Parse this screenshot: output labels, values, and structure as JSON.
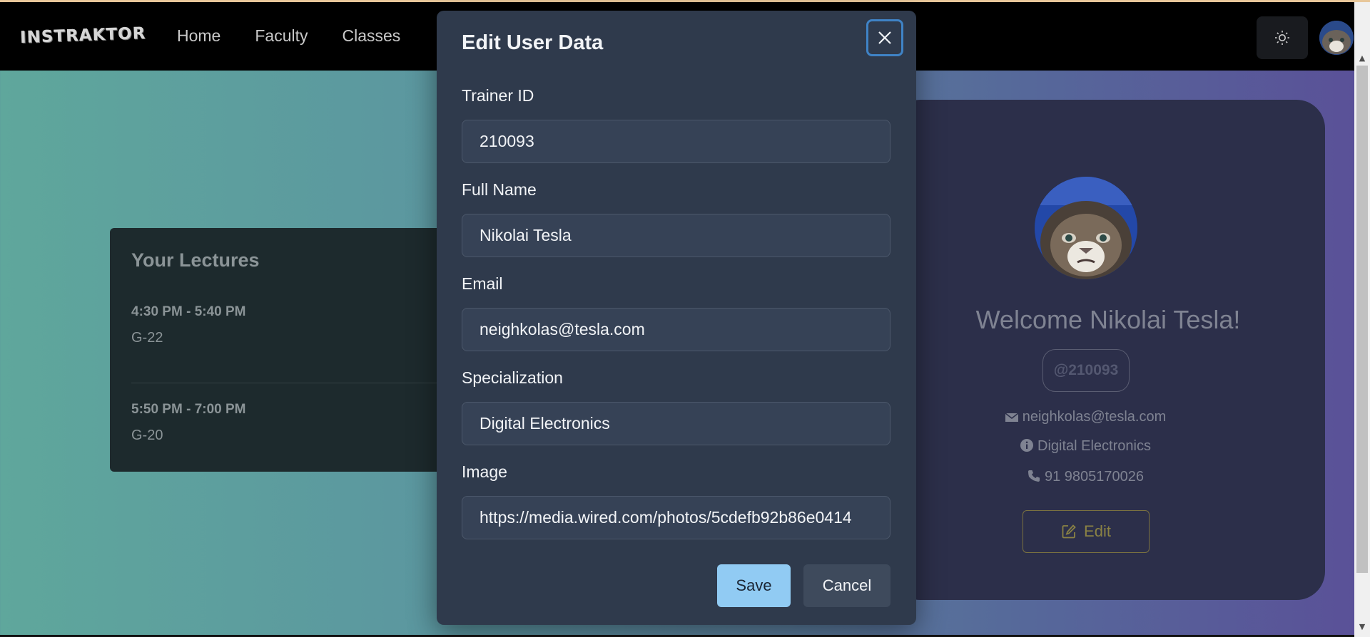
{
  "app": {
    "logo": "INSTRAKTOR"
  },
  "nav": {
    "links": [
      "Home",
      "Faculty",
      "Classes"
    ]
  },
  "lectures": {
    "title": "Your Lectures",
    "items": [
      {
        "time": "4:30 PM - 5:40 PM",
        "room": "G-22"
      },
      {
        "time": "5:50 PM - 7:00 PM",
        "room": "G-20"
      }
    ]
  },
  "profile": {
    "welcome": "Welcome Nikolai Tesla!",
    "handle": "@210093",
    "email": "neighkolas@tesla.com",
    "specialization": "Digital Electronics",
    "phone": "91 9805170026",
    "edit_label": "Edit"
  },
  "modal": {
    "title": "Edit User Data",
    "fields": [
      {
        "label": "Trainer ID",
        "value": "210093"
      },
      {
        "label": "Full Name",
        "value": "Nikolai Tesla"
      },
      {
        "label": "Email",
        "value": "neighkolas@tesla.com"
      },
      {
        "label": "Specialization",
        "value": "Digital Electronics"
      },
      {
        "label": "Image",
        "value": "https://media.wired.com/photos/5cdefb92b86e0414"
      }
    ],
    "save_label": "Save",
    "cancel_label": "Cancel"
  },
  "colors": {
    "accent": "#91cbf3",
    "focus_ring": "#3f83c6",
    "navbar": "#000000",
    "modal_bg": "#2f3a4c"
  },
  "icons": [
    "sun-icon",
    "close-icon",
    "mail-icon",
    "info-icon",
    "phone-icon",
    "edit-icon"
  ]
}
